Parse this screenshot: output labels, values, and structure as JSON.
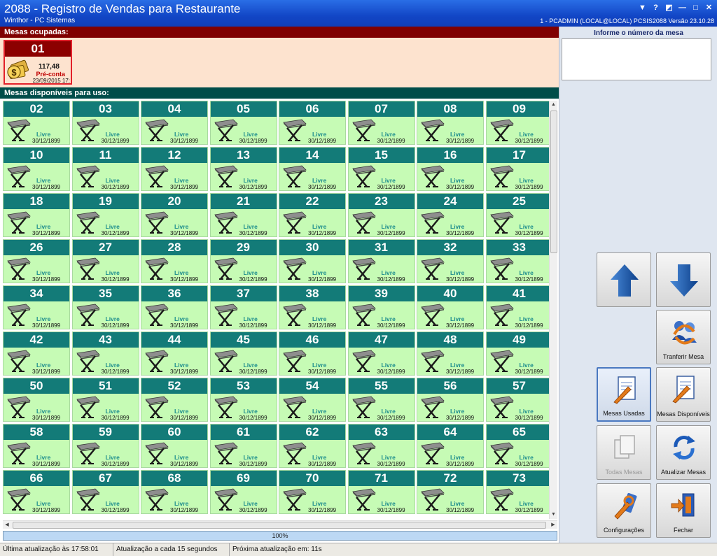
{
  "window": {
    "title": "2088 - Registro de Vendas para Restaurante",
    "subtitle": "Winthor - PC Sistemas",
    "session_info": "1 - PCADMIN (LOCAL@LOCAL)   PCSIS2088   Versão 23.10.28",
    "controls": [
      "▼",
      "?",
      "◩",
      "—",
      "□",
      "✕"
    ]
  },
  "occupied": {
    "header": "Mesas ocupadas:",
    "tables": [
      {
        "number": "01",
        "value": "117,48",
        "status": "Pré-conta",
        "date": "23/09/2015 17:",
        "icon": "money-icon"
      }
    ]
  },
  "available": {
    "header": "Mesas disponíveis para uso:",
    "status_label": "Livre",
    "date_label": "30/12/1899",
    "tables": [
      "02",
      "03",
      "04",
      "05",
      "06",
      "07",
      "08",
      "09",
      "10",
      "11",
      "12",
      "13",
      "14",
      "15",
      "16",
      "17",
      "18",
      "19",
      "20",
      "21",
      "22",
      "23",
      "24",
      "25",
      "26",
      "27",
      "28",
      "29",
      "30",
      "31",
      "32",
      "33",
      "34",
      "35",
      "36",
      "37",
      "38",
      "39",
      "40",
      "41",
      "42",
      "43",
      "44",
      "45",
      "46",
      "47",
      "48",
      "49",
      "50",
      "51",
      "52",
      "53",
      "54",
      "55",
      "56",
      "57",
      "58",
      "59",
      "60",
      "61",
      "62",
      "63",
      "64",
      "65",
      "66",
      "67",
      "68",
      "69",
      "70",
      "71",
      "72",
      "73"
    ]
  },
  "progress": {
    "text": "100%",
    "value": 1.0
  },
  "right_panel": {
    "input_label": "Informe o número da mesa",
    "input_value": "",
    "buttons": {
      "up": "",
      "down": "",
      "transfer": "Tranferir Mesa",
      "used": "Mesas Usadas",
      "available": "Mesas Disponíveis",
      "all": "Todas Mesas",
      "refresh": "Atualizar Mesas",
      "settings": "Configurações",
      "close": "Fechar"
    }
  },
  "status_bar": {
    "last_update": "Última atualização às 17:58:01",
    "interval": "Atualização a cada 15 segundos",
    "next_update": "Próxima atualização em: 11s"
  },
  "colors": {
    "occupied_header": "#800000",
    "available_header": "#004d4a",
    "card_number_bg": "#137b78",
    "card_bg": "#c6fbb5",
    "occupied_bg": "#fde3cf"
  }
}
